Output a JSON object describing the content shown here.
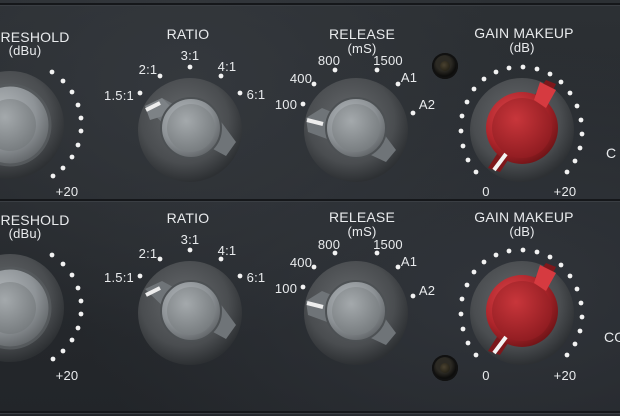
{
  "colors": {
    "panel": "#272a2e",
    "knob_grey": "#8d9296",
    "knob_red": "#b0262c",
    "label": "#e9ebed"
  },
  "rows": [
    {
      "threshold": {
        "title": "RESHOLD",
        "unit": "(dBu)",
        "scale": [
          "+20"
        ]
      },
      "ratio": {
        "title": "RATIO",
        "scale": [
          "1.5:1",
          "2:1",
          "3:1",
          "4:1",
          "6:1"
        ]
      },
      "release": {
        "title": "RELEASE",
        "unit": "(mS)",
        "scale": [
          "100",
          "400",
          "800",
          "1500",
          "A1",
          "A2"
        ]
      },
      "gain": {
        "title": "GAIN MAKEUP",
        "unit": "(dB)",
        "scale": [
          "0",
          "+20"
        ]
      },
      "edge": "C"
    },
    {
      "threshold": {
        "title": "RESHOLD",
        "unit": "(dBu)",
        "scale": [
          "+20"
        ]
      },
      "ratio": {
        "title": "RATIO",
        "scale": [
          "1.5:1",
          "2:1",
          "3:1",
          "4:1",
          "6:1"
        ]
      },
      "release": {
        "title": "RELEASE",
        "unit": "(mS)",
        "scale": [
          "100",
          "400",
          "800",
          "1500",
          "A1",
          "A2"
        ]
      },
      "gain": {
        "title": "GAIN MAKEUP",
        "unit": "(dB)",
        "scale": [
          "0",
          "+20"
        ]
      },
      "edge": "CO"
    }
  ],
  "icons": {
    "knob": "rotary-knob-icon",
    "screw": "panel-screw-icon"
  }
}
